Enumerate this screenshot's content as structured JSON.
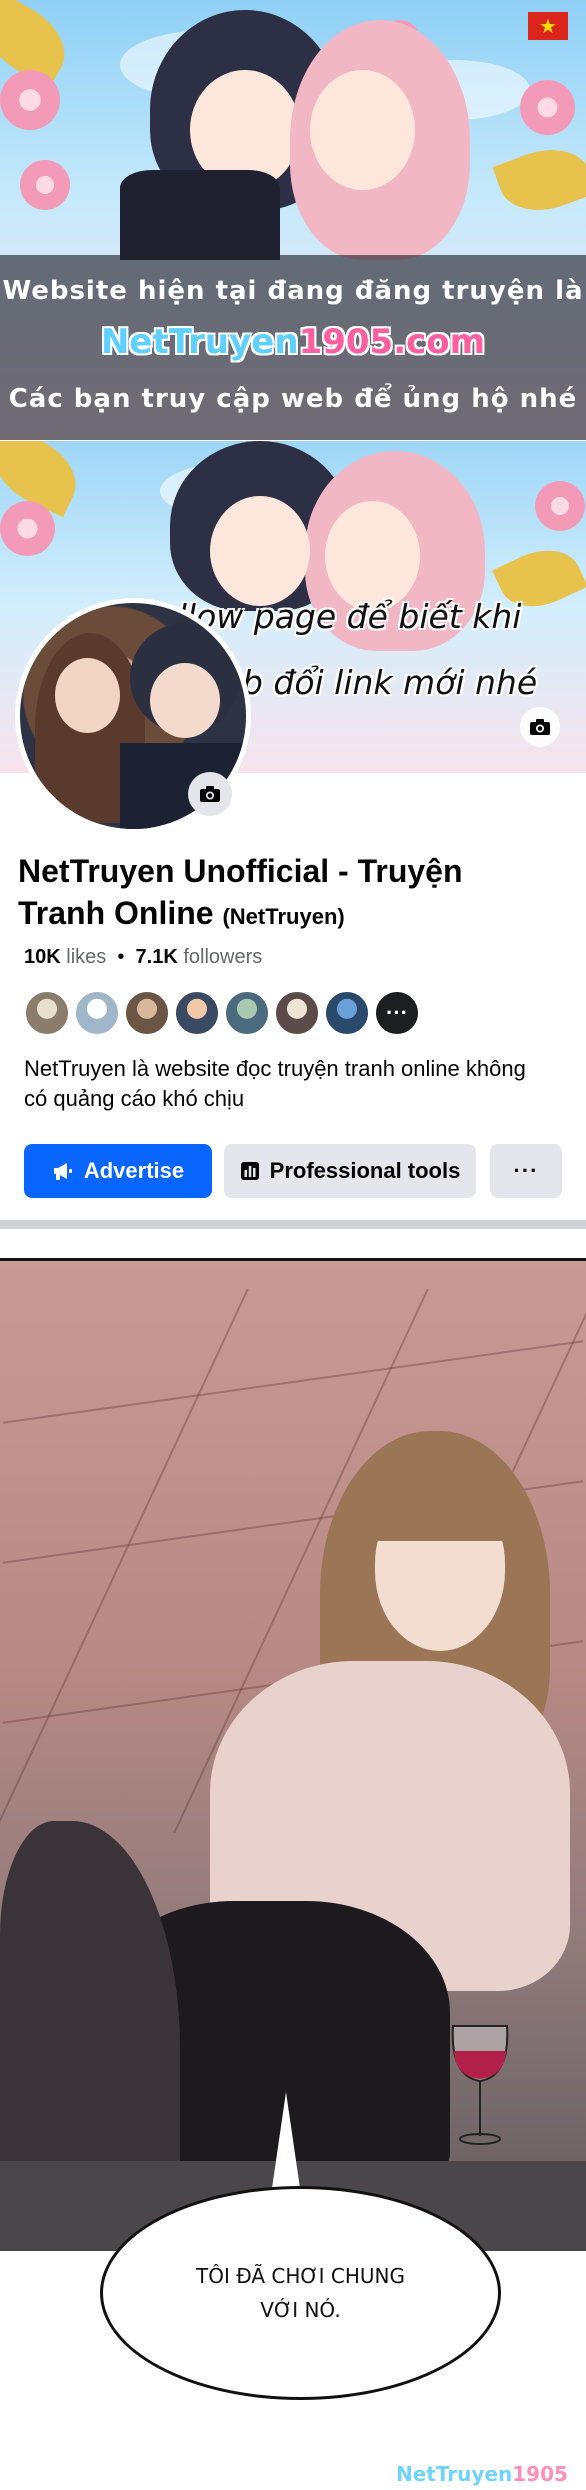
{
  "banner": {
    "line1": "Website hiện tại đang đăng truyện là",
    "site_part1": "NetTruyen",
    "site_part2": "1905",
    "site_part3": ".com",
    "line3": "Các bạn truy cập web để ủng hộ nhé",
    "flag_icon": "vietnam-flag-icon"
  },
  "cover": {
    "caption_line1": "Follow page để biết khi",
    "caption_line2": "nào web đổi link mới nhé"
  },
  "profile": {
    "name": "NetTruyen Unofficial - Truyện Tranh Online",
    "handle": "(NetTruyen)",
    "likes_count": "10K",
    "likes_label": "likes",
    "separator": "•",
    "followers_count": "7.1K",
    "followers_label": "followers",
    "more_friends": "···",
    "bio": "NetTruyen là website đọc truyện tranh online không có quảng cáo khó chịu"
  },
  "actions": {
    "advertise": "Advertise",
    "professional_tools": "Professional tools",
    "more": "···"
  },
  "comic": {
    "bubble_line1": "TÔI ĐÃ CHƠI CHUNG",
    "bubble_line2": "VỚI NÓ."
  },
  "watermark": {
    "part1": "NetTruyen",
    "part2": "1905"
  },
  "colors": {
    "primary_button": "#0866ff",
    "secondary_button": "#e4e6eb",
    "flag_red": "#da251d"
  }
}
